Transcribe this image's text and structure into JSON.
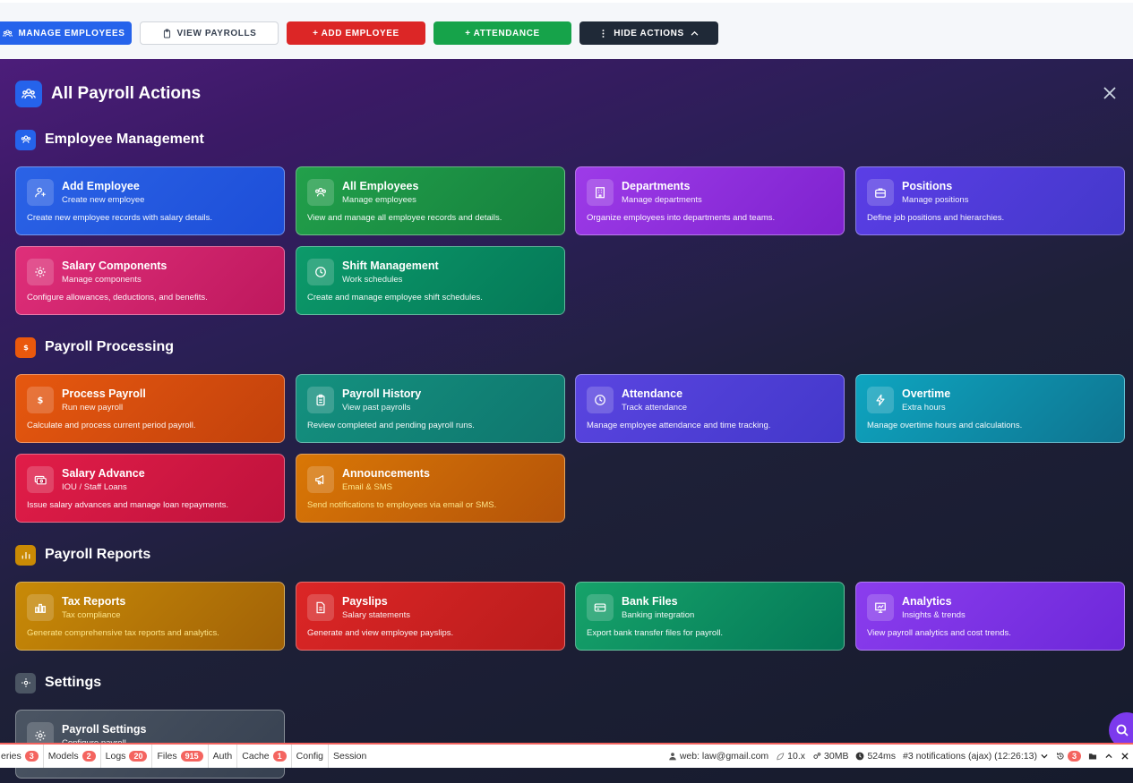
{
  "toolbar": {
    "manage": "MANAGE EMPLOYEES",
    "view": "VIEW PAYROLLS",
    "add": "+  ADD EMPLOYEE",
    "attendance": "+  ATTENDANCE",
    "hide": "HIDE ACTIONS"
  },
  "panel": {
    "title": "All Payroll Actions"
  },
  "sections": {
    "employee": {
      "title": "Employee Management",
      "cards": [
        {
          "title": "Add Employee",
          "sub": "Create new employee",
          "desc": "Create new employee records with salary details."
        },
        {
          "title": "All Employees",
          "sub": "Manage employees",
          "desc": "View and manage all employee records and details."
        },
        {
          "title": "Departments",
          "sub": "Manage departments",
          "desc": "Organize employees into departments and teams."
        },
        {
          "title": "Positions",
          "sub": "Manage positions",
          "desc": "Define job positions and hierarchies."
        },
        {
          "title": "Salary Components",
          "sub": "Manage components",
          "desc": "Configure allowances, deductions, and benefits."
        },
        {
          "title": "Shift Management",
          "sub": "Work schedules",
          "desc": "Create and manage employee shift schedules."
        }
      ]
    },
    "processing": {
      "title": "Payroll Processing",
      "cards": [
        {
          "title": "Process Payroll",
          "sub": "Run new payroll",
          "desc": "Calculate and process current period payroll."
        },
        {
          "title": "Payroll History",
          "sub": "View past payrolls",
          "desc": "Review completed and pending payroll runs."
        },
        {
          "title": "Attendance",
          "sub": "Track attendance",
          "desc": "Manage employee attendance and time tracking."
        },
        {
          "title": "Overtime",
          "sub": "Extra hours",
          "desc": "Manage overtime hours and calculations."
        },
        {
          "title": "Salary Advance",
          "sub": "IOU / Staff Loans",
          "desc": "Issue salary advances and manage loan repayments."
        },
        {
          "title": "Announcements",
          "sub": "Email & SMS",
          "desc": "Send notifications to employees via email or SMS."
        }
      ]
    },
    "reports": {
      "title": "Payroll Reports",
      "cards": [
        {
          "title": "Tax Reports",
          "sub": "Tax compliance",
          "desc": "Generate comprehensive tax reports and analytics."
        },
        {
          "title": "Payslips",
          "sub": "Salary statements",
          "desc": "Generate and view employee payslips."
        },
        {
          "title": "Bank Files",
          "sub": "Banking integration",
          "desc": "Export bank transfer files for payroll."
        },
        {
          "title": "Analytics",
          "sub": "Insights & trends",
          "desc": "View payroll analytics and cost trends."
        }
      ]
    },
    "settings": {
      "title": "Settings",
      "cards": [
        {
          "title": "Payroll Settings",
          "sub": "Configure payroll",
          "desc": ""
        }
      ]
    }
  },
  "debugbar": {
    "tabs": [
      {
        "label": "eries",
        "count": "3"
      },
      {
        "label": "Models",
        "count": "2"
      },
      {
        "label": "Logs",
        "count": "20"
      },
      {
        "label": "Files",
        "count": "915"
      },
      {
        "label": "Auth",
        "count": ""
      },
      {
        "label": "Cache",
        "count": "1"
      },
      {
        "label": "Config",
        "count": ""
      },
      {
        "label": "Session",
        "count": ""
      }
    ],
    "user": "web: law@gmail.com",
    "version": "10.x",
    "memory": "30MB",
    "time": "524ms",
    "request": "#3 notifications (ajax) (12:26:13)",
    "history_count": "3"
  },
  "colors": {
    "accent": "#2563eb",
    "debug_red": "#f4645f"
  }
}
